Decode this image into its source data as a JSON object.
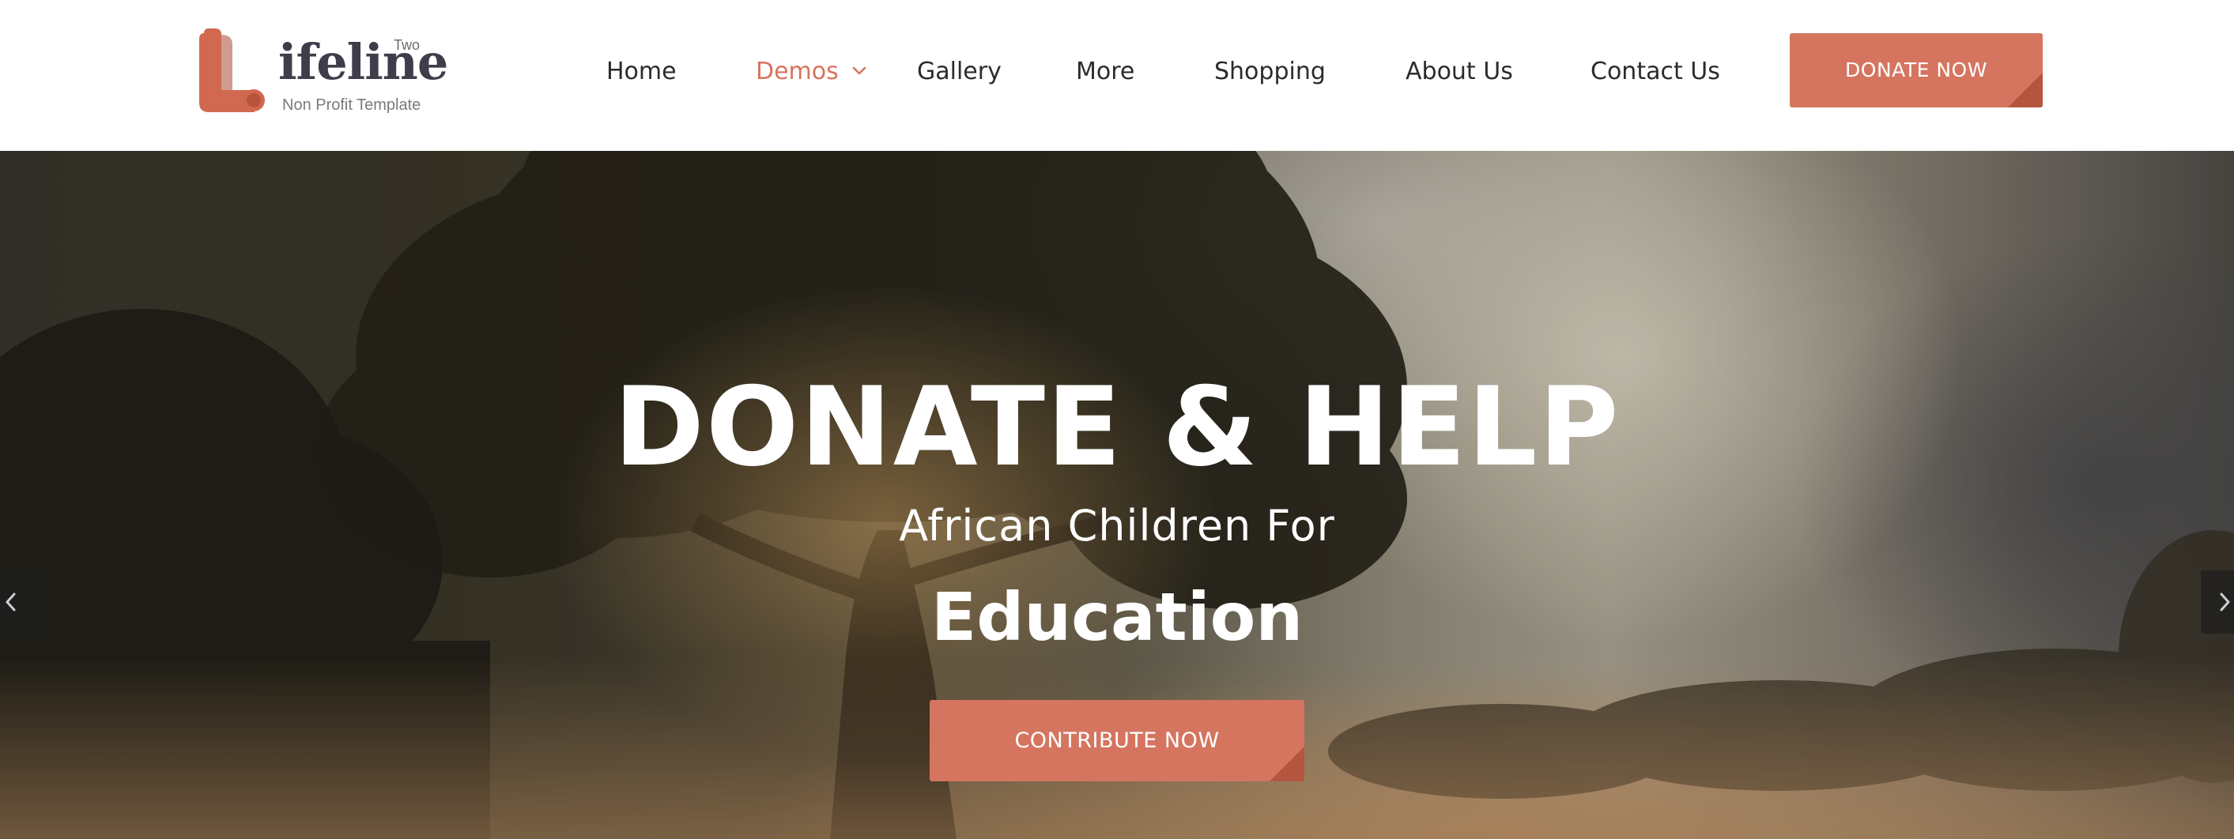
{
  "brand": {
    "initial": "L",
    "wordmark": "ifeline",
    "superscript": "Two",
    "tagline": "Non Profit Template",
    "accent_color": "#d57560"
  },
  "nav": {
    "items": [
      {
        "label": "Home",
        "active": false
      },
      {
        "label": "Demos",
        "active": true,
        "has_dropdown": true,
        "icon": "chevron-down-icon"
      },
      {
        "label": "Gallery",
        "active": false
      },
      {
        "label": "More",
        "active": false
      },
      {
        "label": "Shopping",
        "active": false
      },
      {
        "label": "About Us",
        "active": false
      },
      {
        "label": "Contact Us",
        "active": false
      }
    ],
    "donate_label": "DONATE NOW"
  },
  "hero": {
    "title": "DONATE & HELP",
    "subtitle": "African Children For",
    "highlight": "Education",
    "cta_label": "CONTRIBUTE NOW",
    "prev_icon": "chevron-left-icon",
    "next_icon": "chevron-right-icon"
  }
}
